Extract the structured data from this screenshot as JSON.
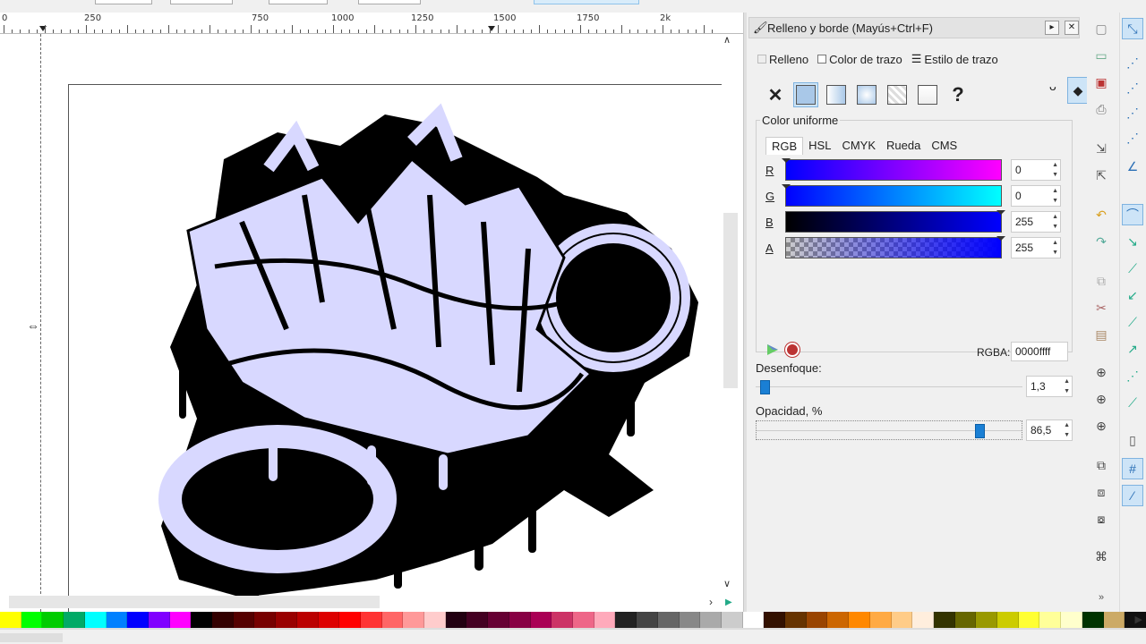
{
  "ruler": {
    "labels": [
      "0",
      "250",
      "750",
      "1000",
      "1250",
      "1500",
      "1750",
      "2k"
    ]
  },
  "dialog": {
    "title": "Relleno y borde (Mayús+Ctrl+F)",
    "tabs": [
      "Relleno",
      "Color de trazo",
      "Estilo de trazo"
    ],
    "unset_glyph": "?",
    "none_glyph": "✕",
    "color_section_title": "Color uniforme",
    "color_modes": [
      "RGB",
      "HSL",
      "CMYK",
      "Rueda",
      "CMS"
    ],
    "channels": [
      {
        "label": "R",
        "value": "0"
      },
      {
        "label": "G",
        "value": "0"
      },
      {
        "label": "B",
        "value": "255"
      },
      {
        "label": "A",
        "value": "255"
      }
    ],
    "rgba_label": "RGBA:",
    "rgba_value": "0000ffff",
    "blur_label": "Desenfoque:",
    "blur_value": "1,3",
    "opacity_label": "Opacidad, %",
    "opacity_value": "86,5"
  },
  "colors": {
    "accent": "#1a7fd4",
    "art_fill": "#d8d8ff",
    "art_stroke": "#000000"
  },
  "icons": {
    "cmd": [
      "new-document-icon",
      "open-icon",
      "save-icon",
      "print-icon",
      "import-icon",
      "export-icon",
      "undo-icon",
      "redo-icon",
      "copy-icon",
      "cut-icon",
      "paste-icon",
      "zoom-selection-icon",
      "zoom-drawing-icon",
      "zoom-page-icon",
      "duplicate-icon",
      "clone-icon",
      "unlink-clone-icon",
      "xml-editor-icon",
      "more-icon"
    ],
    "snap": [
      "snap-toggle-icon",
      "snap-bbox-icon",
      "snap-edge-icon",
      "snap-corner-icon",
      "snap-nodes-icon",
      "snap-path-icon",
      "snap-intersection-icon",
      "snap-smooth-icon",
      "snap-midpoint-icon",
      "snap-center-icon",
      "snap-rotation-icon",
      "snap-page-icon",
      "snap-grid-icon",
      "snap-guide-icon"
    ]
  }
}
